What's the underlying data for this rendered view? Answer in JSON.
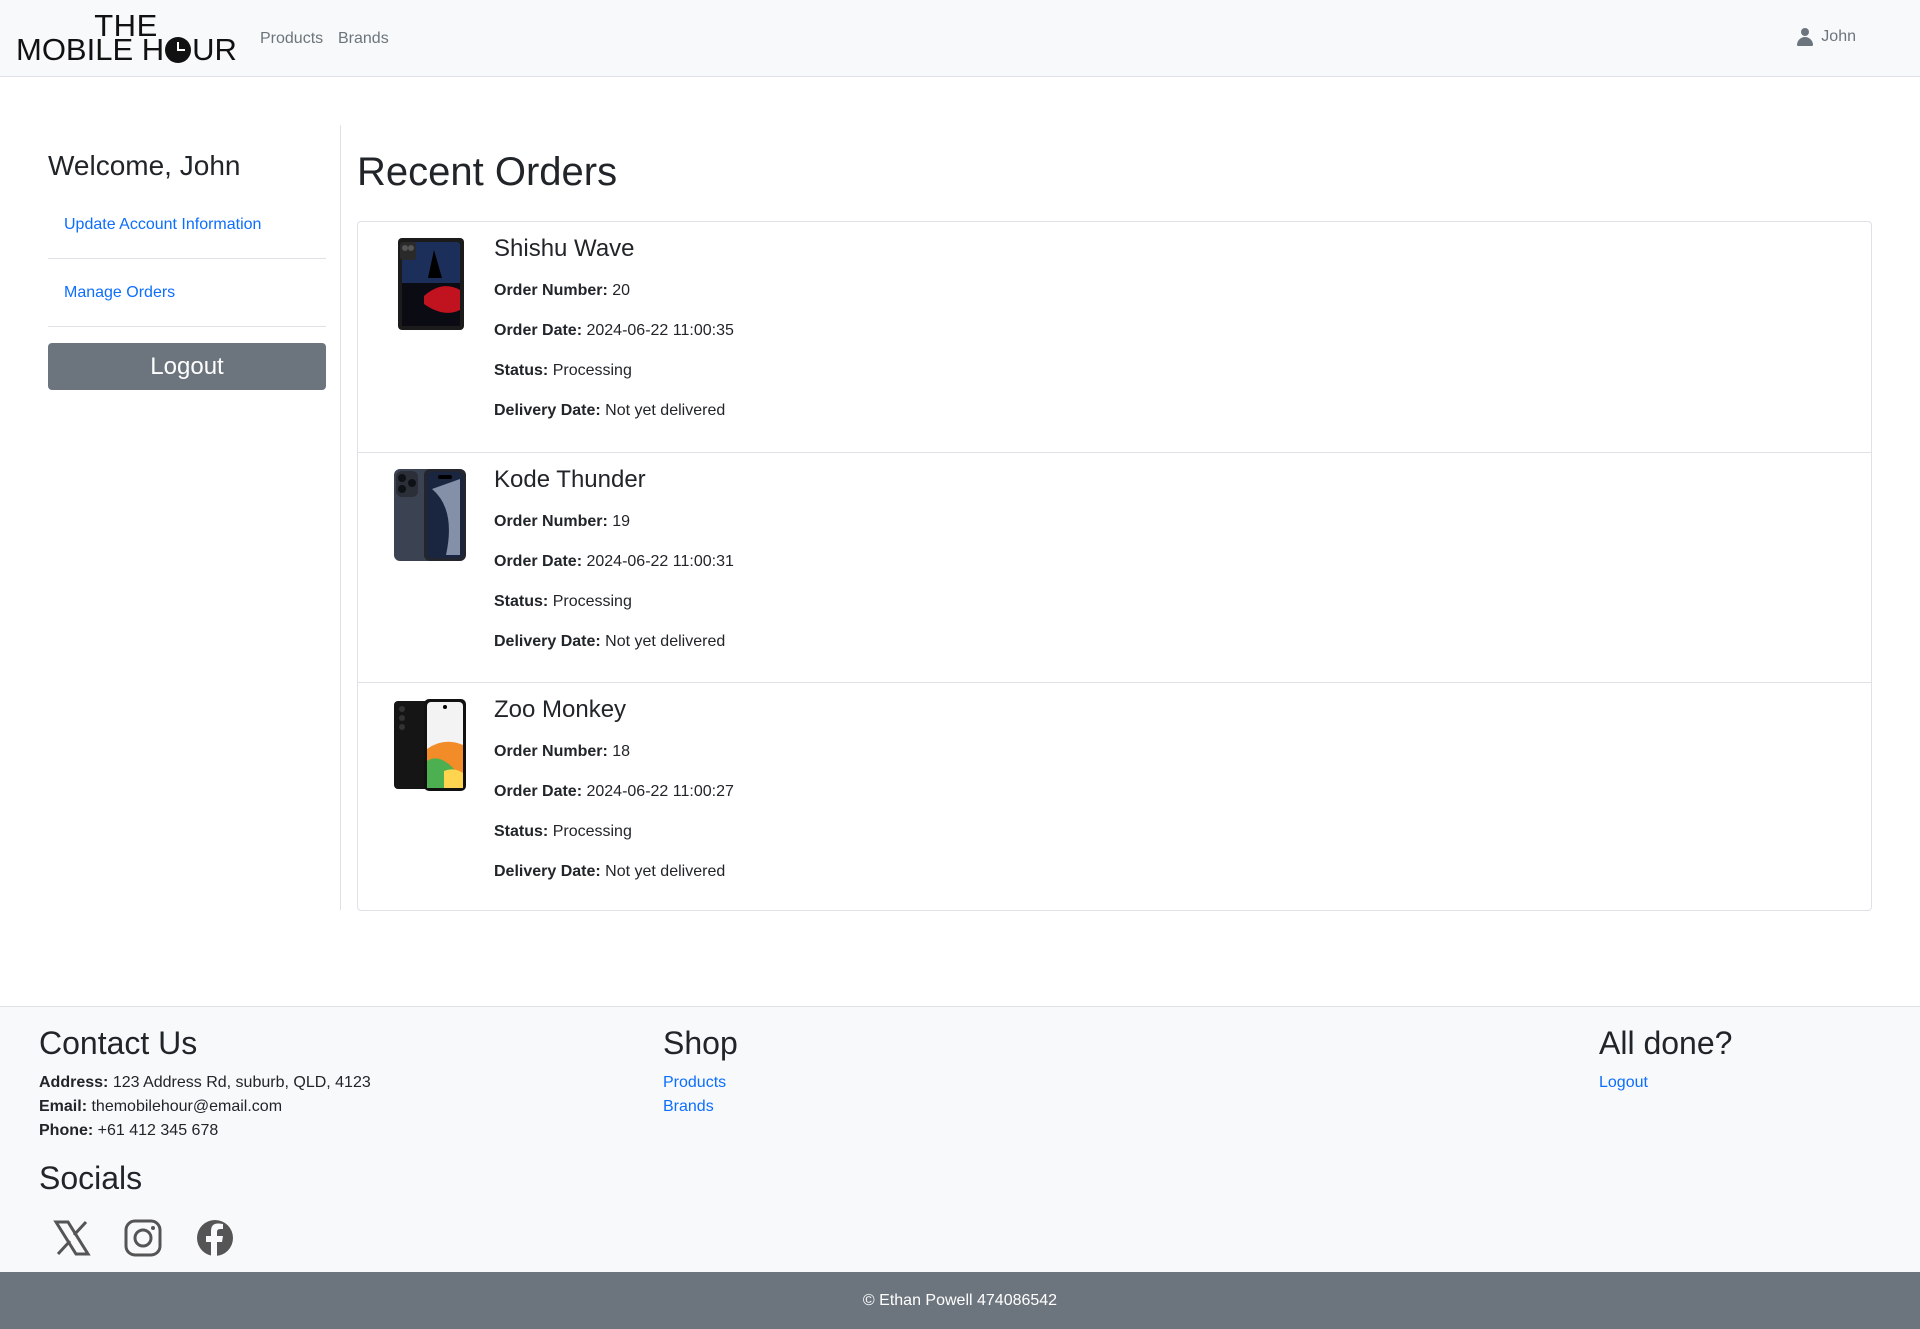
{
  "navbar": {
    "logo_line1": "THE",
    "logo_line2_a": "MOBILE H",
    "logo_line2_b": "UR",
    "links": [
      {
        "label": "Products"
      },
      {
        "label": "Brands"
      }
    ],
    "user": "John"
  },
  "sidebar": {
    "welcome": "Welcome, John",
    "links": [
      {
        "label": "Update Account Information"
      },
      {
        "label": "Manage Orders"
      }
    ],
    "logout_label": "Logout"
  },
  "main": {
    "title": "Recent Orders",
    "labels": {
      "order_number": "Order Number:",
      "order_date": "Order Date:",
      "status": "Status:",
      "delivery_date": "Delivery Date:"
    },
    "orders": [
      {
        "name": "Shishu Wave",
        "order_number": "20",
        "order_date": "2024-06-22 11:00:35",
        "status": "Processing",
        "delivery_date": "Not yet delivered"
      },
      {
        "name": "Kode Thunder",
        "order_number": "19",
        "order_date": "2024-06-22 11:00:31",
        "status": "Processing",
        "delivery_date": "Not yet delivered"
      },
      {
        "name": "Zoo Monkey",
        "order_number": "18",
        "order_date": "2024-06-22 11:00:27",
        "status": "Processing",
        "delivery_date": "Not yet delivered"
      }
    ]
  },
  "footer": {
    "contact": {
      "heading": "Contact Us",
      "address_label": "Address:",
      "address": "123 Address Rd, suburb, QLD, 4123",
      "email_label": "Email:",
      "email": "themobilehour@email.com",
      "phone_label": "Phone:",
      "phone": "+61 412 345 678"
    },
    "shop": {
      "heading": "Shop",
      "links": [
        {
          "label": "Products"
        },
        {
          "label": "Brands"
        }
      ]
    },
    "done": {
      "heading": "All done?",
      "logout_label": "Logout"
    },
    "socials": {
      "heading": "Socials",
      "icons": [
        "x-icon",
        "instagram-icon",
        "facebook-icon"
      ]
    },
    "copyright": "© Ethan Powell 474086542"
  },
  "colors": {
    "link": "#0d6efd",
    "secondary": "#6c757d",
    "light": "#f8f9fa",
    "border": "#dee2e6"
  }
}
